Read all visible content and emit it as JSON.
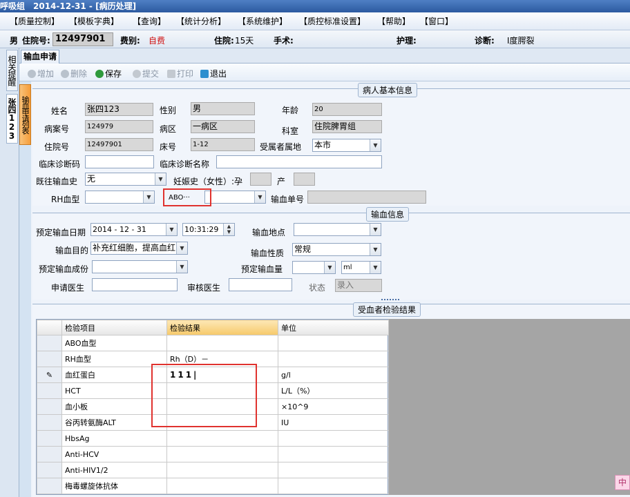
{
  "app": {
    "title": "呼吸组　2014-12-31 - [病历处理]"
  },
  "menu": [
    {
      "label": "【质量控制】"
    },
    {
      "label": "【模板字典】"
    },
    {
      "label": "【查询】"
    },
    {
      "label": "【统计分析】"
    },
    {
      "label": "【系统维护】"
    },
    {
      "label": "【质控标准设置】"
    },
    {
      "label": "【帮助】"
    },
    {
      "label": "【窗口】"
    }
  ],
  "patient": {
    "gender_label": "男",
    "id_label": "住院号:",
    "id_value": "12497901",
    "fee_label": "费别:",
    "fee_value": "自费",
    "stay_label": "住院:",
    "stay_value": "15天",
    "surgery_label": "手术:",
    "nursing_label": "护理:",
    "diagnosis_label": "诊断:",
    "diagnosis_value": "Ⅰ度腭裂"
  },
  "left_tabs": {
    "reminder": "相关提醒",
    "patient": "张四123",
    "list": "输血申请列表"
  },
  "tab": {
    "active": "输血申请"
  },
  "toolbar": {
    "add": "增加",
    "delete": "删除",
    "save": "保存",
    "submit": "提交",
    "print": "打印",
    "exit": "退出"
  },
  "basic": {
    "title": "病人基本信息",
    "name_label": "姓名",
    "name": "张四123",
    "sex_label": "性别",
    "sex": "男",
    "age_label": "年龄",
    "age": "20",
    "case_label": "病案号",
    "case": "124979",
    "ward_label": "病区",
    "ward": "一病区",
    "dept_label": "科室",
    "dept": "住院脾胃组",
    "inpatient_label": "住院号",
    "inpatient": "12497901",
    "bed_label": "床号",
    "bed": "1-12",
    "residence_label": "受属者属地",
    "residence": "本市",
    "diag_code_label": "临床诊断码",
    "diag_code": "",
    "diag_name_label": "临床诊断名称",
    "diag_name": "",
    "history_label": "既往输血史",
    "history": "无",
    "pregnancy_label": "妊娠史（女性）:孕",
    "pregnancy": "",
    "birth_label": "产",
    "birth": "",
    "rh_label": "RH血型",
    "rh": "",
    "abo_label": "ABO···",
    "abo": "",
    "order_label": "输血单号",
    "order": ""
  },
  "transfusion": {
    "title": "输血信息",
    "date_label": "预定输血日期",
    "date": "2014 - 12 - 31",
    "time": "10:31:29",
    "place_label": "输血地点",
    "place": "",
    "purpose_label": "输血目的",
    "purpose": "补充红细胞，提高血红",
    "nature_label": "输血性质",
    "nature": "常规",
    "component_label": "预定输血成份",
    "component": "",
    "amount_label": "预定输血量",
    "amount": "",
    "unit": "ml",
    "applicant_label": "申请医生",
    "applicant": "",
    "reviewer_label": "审核医生",
    "reviewer": "",
    "status_label": "状态",
    "status": "录入"
  },
  "results": {
    "title": "受血者检验结果",
    "columns": [
      "检验项目",
      "检验结果",
      "单位"
    ],
    "rows": [
      {
        "item": "ABO血型",
        "result": "",
        "unit": ""
      },
      {
        "item": "RH血型",
        "result": "Rh（D）－",
        "unit": ""
      },
      {
        "item": "血红蛋白",
        "result": "111|",
        "unit": "g/l"
      },
      {
        "item": "HCT",
        "result": "",
        "unit": "L/L（%）"
      },
      {
        "item": "血小板",
        "result": "",
        "unit": "×10^9"
      },
      {
        "item": "谷丙转氨酶ALT",
        "result": "",
        "unit": "IU"
      },
      {
        "item": "HbsAg",
        "result": "",
        "unit": ""
      },
      {
        "item": "Anti-HCV",
        "result": "",
        "unit": ""
      },
      {
        "item": "Anti-HIV1/2",
        "result": "",
        "unit": ""
      },
      {
        "item": "梅毒螺旋体抗体",
        "result": "",
        "unit": ""
      }
    ]
  },
  "corner_button": "中"
}
